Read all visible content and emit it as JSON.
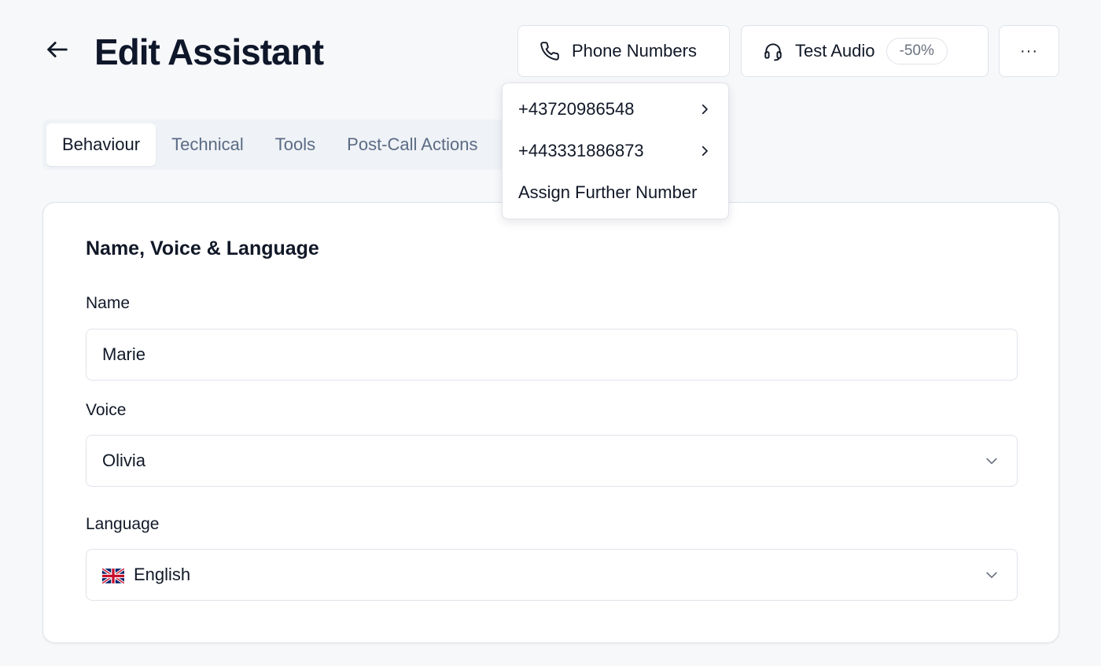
{
  "header": {
    "title": "Edit Assistant",
    "phone_numbers_label": "Phone Numbers",
    "test_audio_label": "Test Audio",
    "test_audio_badge": "-50%",
    "more_label": "···"
  },
  "tabs": [
    {
      "label": "Behaviour",
      "active": true
    },
    {
      "label": "Technical",
      "active": false
    },
    {
      "label": "Tools",
      "active": false
    },
    {
      "label": "Post-Call Actions",
      "active": false
    }
  ],
  "phone_dropdown": {
    "items": [
      {
        "label": "+43720986548"
      },
      {
        "label": "+443331886873"
      }
    ],
    "assign_label": "Assign Further Number"
  },
  "card": {
    "section_title": "Name, Voice & Language",
    "name": {
      "label": "Name",
      "value": "Marie"
    },
    "voice": {
      "label": "Voice",
      "value": "Olivia"
    },
    "language": {
      "label": "Language",
      "value": "English",
      "flag": "uk-flag"
    }
  },
  "icons": {
    "back": "arrow-left-icon",
    "phone": "phone-icon",
    "headset": "headset-icon",
    "chevron_right": "chevron-right-icon",
    "chevron_down": "chevron-down-icon"
  },
  "colors": {
    "background": "#f7f8fa",
    "border": "#dfe3ea",
    "tab_inactive": "#5b6b85",
    "text": "#111827"
  }
}
